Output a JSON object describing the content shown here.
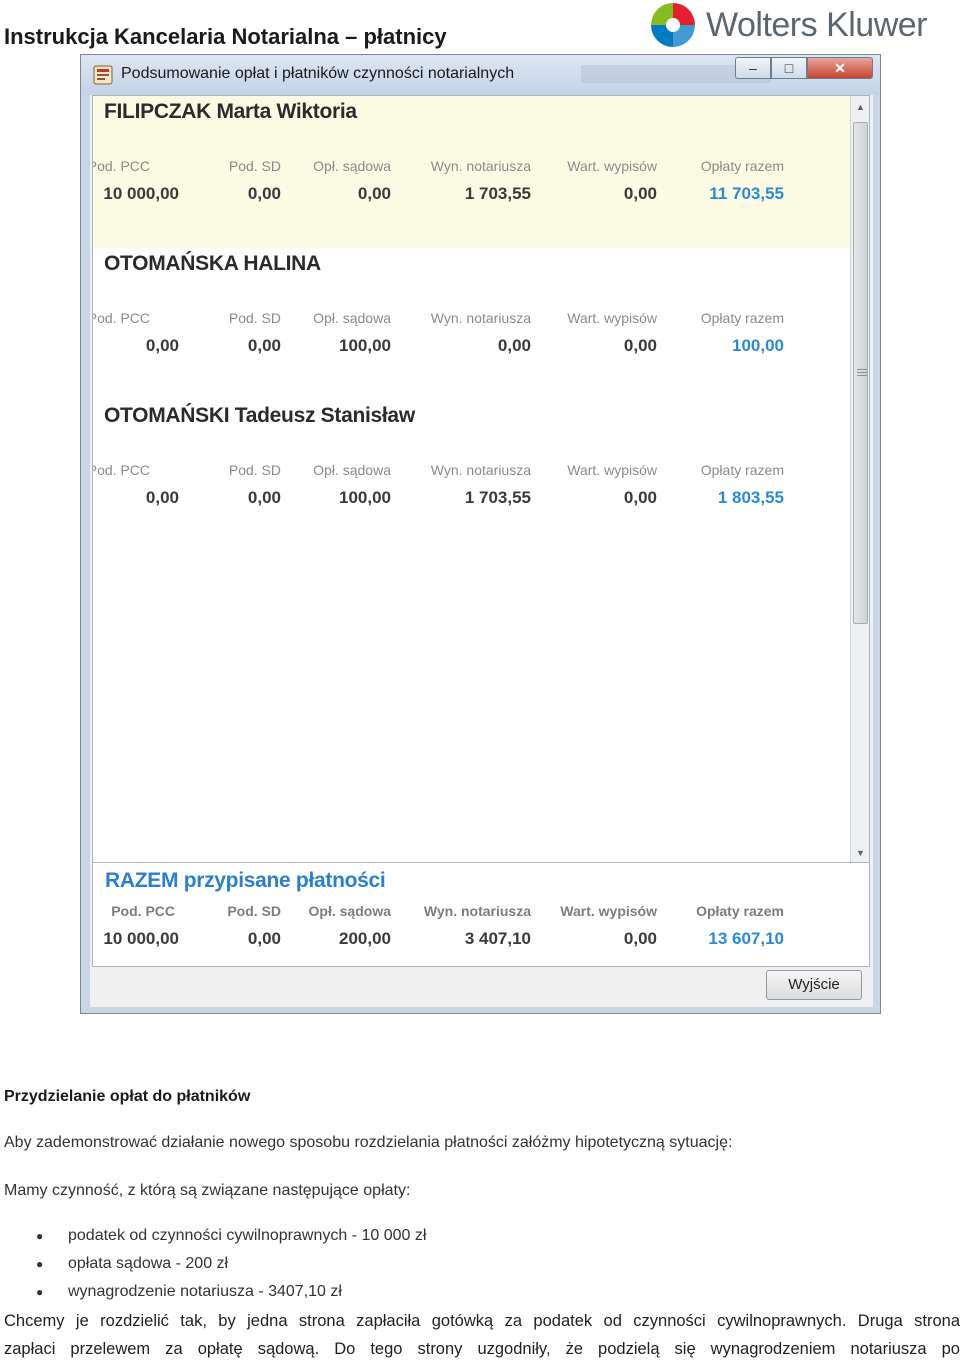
{
  "doc_title": "Instrukcja Kancelaria Notarialna – płatnicy",
  "logo": {
    "text": "Wolters Kluwer",
    "colors": [
      "#85bc22",
      "#007ac3",
      "#e5202e",
      "#409bd2",
      "#5b6670"
    ]
  },
  "window": {
    "title": "Podsumowanie opłat i płatników czynności notarialnych",
    "controls": {
      "minimize": "–",
      "maximize": "□",
      "close": "✕"
    },
    "columns": [
      "Pod. PCC",
      "Pod. SD",
      "Opł. sądowa",
      "Wyn. notariusza",
      "Wart. wypisów",
      "Opłaty razem"
    ],
    "payers": [
      {
        "name": "FILIPCZAK Marta Wiktoria",
        "values": [
          "10 000,00",
          "0,00",
          "0,00",
          "1 703,55",
          "0,00",
          "11 703,55"
        ]
      },
      {
        "name": "OTOMAŃSKA HALINA",
        "values": [
          "0,00",
          "0,00",
          "100,00",
          "0,00",
          "0,00",
          "100,00"
        ]
      },
      {
        "name": "OTOMAŃSKI Tadeusz Stanisław",
        "values": [
          "0,00",
          "0,00",
          "100,00",
          "1 703,55",
          "0,00",
          "1 803,55"
        ]
      }
    ],
    "summary": {
      "title": "RAZEM przypisane płatności",
      "values": [
        "10 000,00",
        "0,00",
        "200,00",
        "3 407,10",
        "0,00",
        "13 607,10"
      ]
    },
    "exit_button": "Wyjście"
  },
  "section_title": "Przydzielanie opłat do płatników",
  "paragraph1": "Aby zademonstrować działanie nowego sposobu rozdzielania płatności załóżmy hipotetyczną sytuację:",
  "paragraph2": "Mamy czynność, z którą są związane następujące opłaty:",
  "bullets": [
    "podatek od czynności cywilnoprawnych - 10 000 zł",
    "opłata sądowa - 200 zł",
    "wynagrodzenie notariusza - 3407,10 zł"
  ],
  "paragraph3_line1": "Chcemy je rozdzielić tak, by jedna strona zapłaciła gotówką za podatek od czynności cywilnoprawnych. Druga strona",
  "paragraph3_line2": "zapłaci przelewem za opłatę sądową. Do tego strony uzgodniły, że podzielą się wynagrodzeniem notariusza po"
}
